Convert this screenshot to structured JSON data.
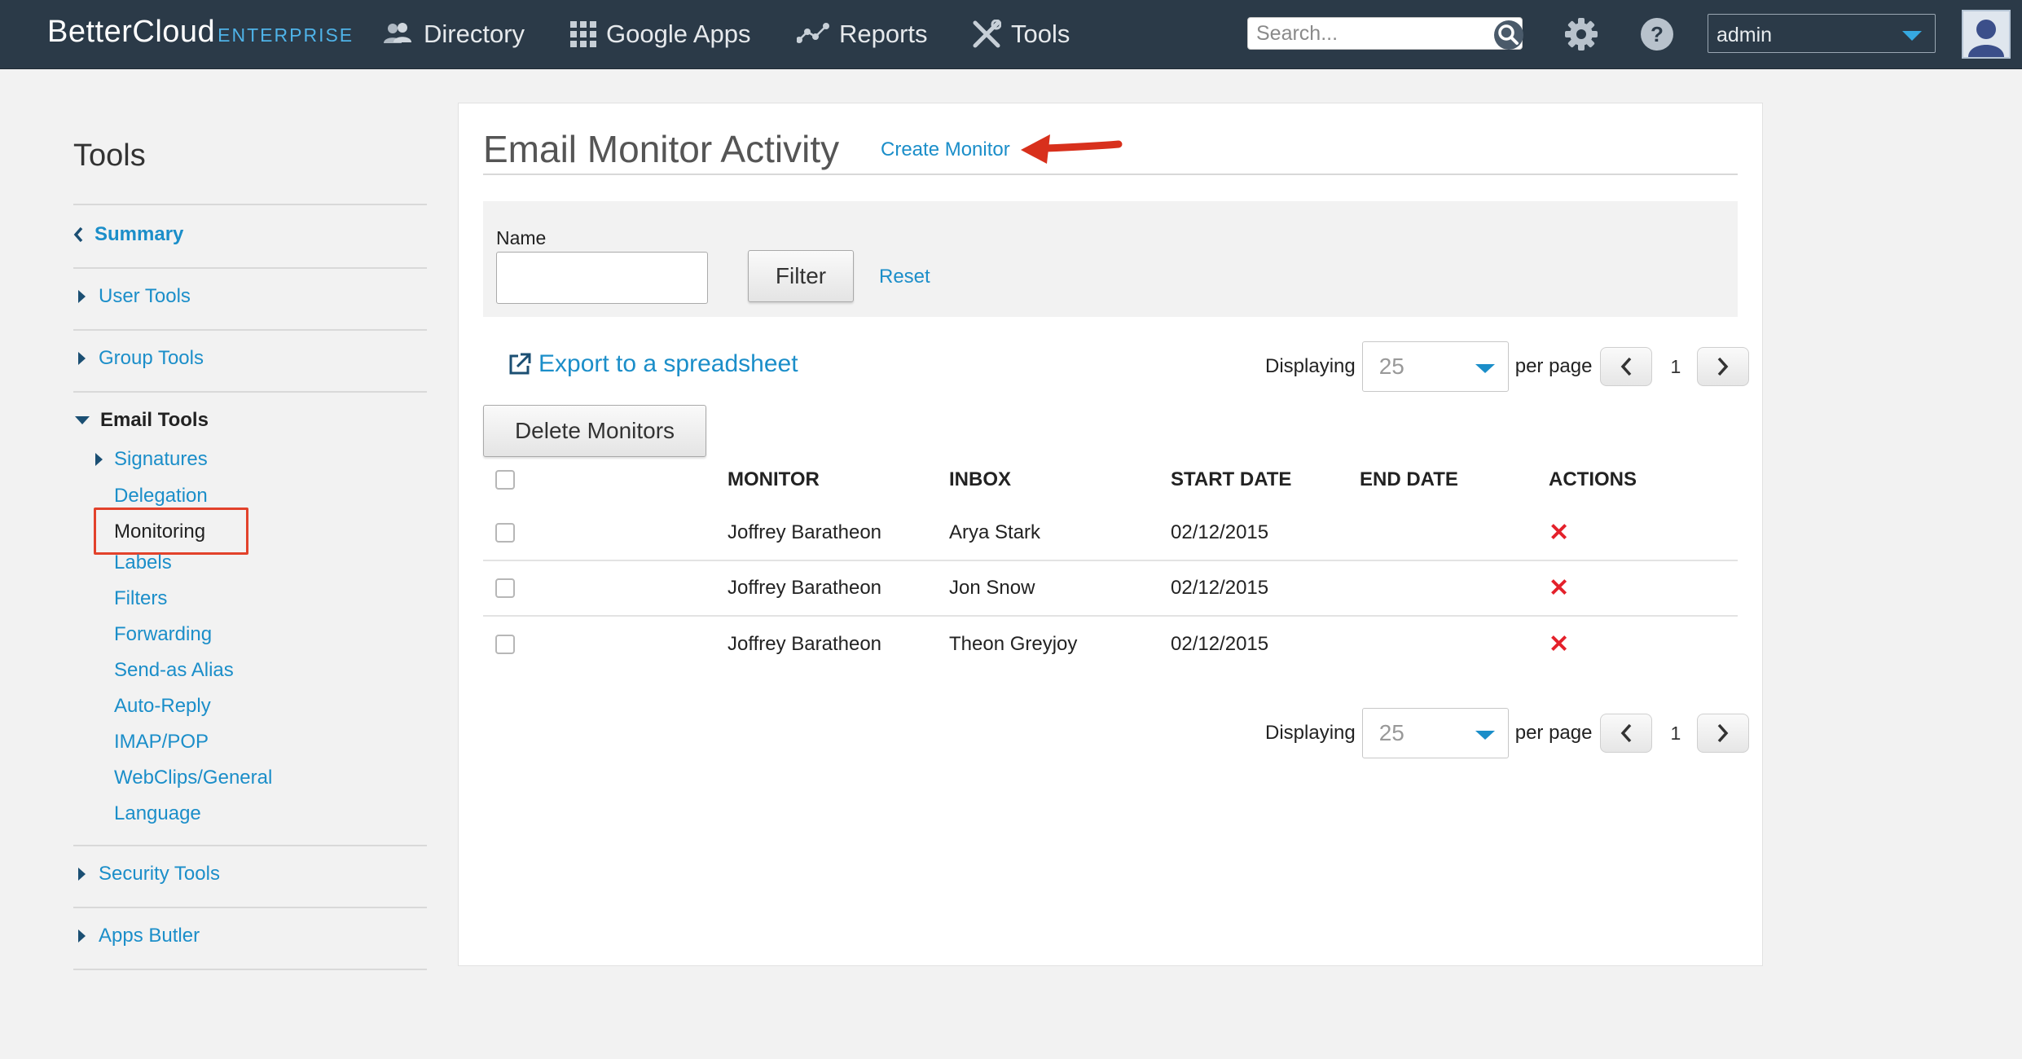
{
  "colors": {
    "topbar": "#2b3a48",
    "accent": "#1b8ec9",
    "highlight": "#e2422b",
    "delete_icon": "#e4212b"
  },
  "brand": {
    "name": "BetterCloud",
    "edition": "ENTERPRISE"
  },
  "nav": [
    {
      "label": "Directory",
      "icon": "users-icon"
    },
    {
      "label": "Google Apps",
      "icon": "grid-icon"
    },
    {
      "label": "Reports",
      "icon": "chart-line-icon"
    },
    {
      "label": "Tools",
      "icon": "wrench-icon"
    }
  ],
  "search": {
    "placeholder": "Search..."
  },
  "user_menu": {
    "selected": "admin"
  },
  "sidebar": {
    "title": "Tools",
    "summary": "Summary",
    "user_tools": "User Tools",
    "group_tools": "Group Tools",
    "email_tools": "Email Tools",
    "email_items": [
      "Signatures",
      "Delegation",
      "Monitoring",
      "Labels",
      "Filters",
      "Forwarding",
      "Send-as Alias",
      "Auto-Reply",
      "IMAP/POP",
      "WebClips/General",
      "Language"
    ],
    "security_tools": "Security Tools",
    "apps_butler": "Apps Butler"
  },
  "main": {
    "title": "Email Monitor Activity",
    "create_link": "Create Monitor",
    "filter": {
      "name_label": "Name",
      "name_value": "",
      "filter_button": "Filter",
      "reset_link": "Reset"
    },
    "export_link": "Export to a spreadsheet",
    "delete_button": "Delete Monitors",
    "pagination": {
      "displaying_label": "Displaying",
      "per_page_value": "25",
      "per_page_label": "per page",
      "page": "1"
    },
    "table": {
      "columns": [
        "MONITOR",
        "INBOX",
        "START DATE",
        "END DATE",
        "ACTIONS"
      ],
      "rows": [
        {
          "monitor": "Joffrey Baratheon",
          "inbox": "Arya Stark",
          "start_date": "02/12/2015",
          "end_date": "",
          "action": "✕"
        },
        {
          "monitor": "Joffrey Baratheon",
          "inbox": "Jon Snow",
          "start_date": "02/12/2015",
          "end_date": "",
          "action": "✕"
        },
        {
          "monitor": "Joffrey Baratheon",
          "inbox": "Theon Greyjoy",
          "start_date": "02/12/2015",
          "end_date": "",
          "action": "✕"
        }
      ]
    }
  }
}
